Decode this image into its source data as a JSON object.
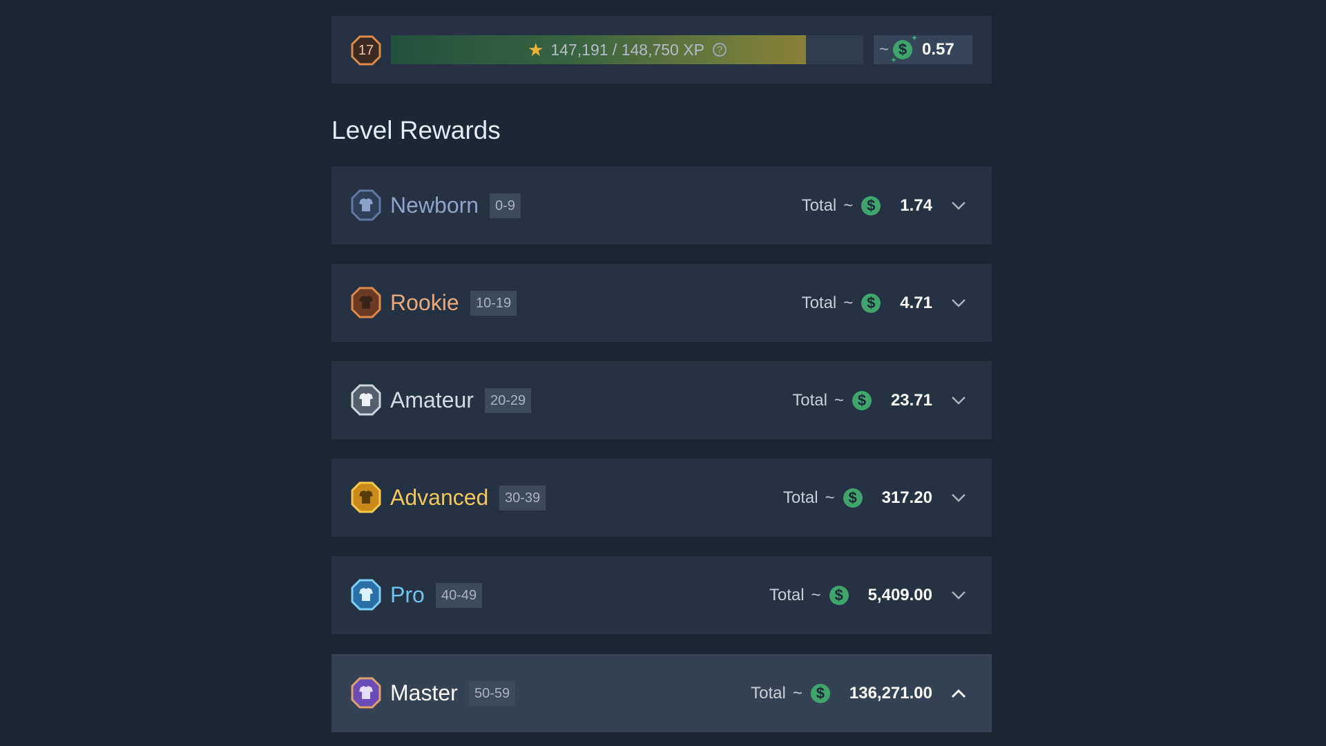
{
  "header": {
    "level": "17",
    "xp_text": "147,191 / 148,750 XP",
    "xp_progress": 0.9431,
    "balance_prefix": "~",
    "balance": "0.57"
  },
  "section_title": "Level Rewards",
  "tiers": [
    {
      "name": "Newborn",
      "range": "0-9",
      "total_label": "Total",
      "tilde": "~",
      "amount": "1.74",
      "color": "#8ea4c8",
      "expanded": false
    },
    {
      "name": "Rookie",
      "range": "10-19",
      "total_label": "Total",
      "tilde": "~",
      "amount": "4.71",
      "color": "#e9a97c",
      "expanded": false
    },
    {
      "name": "Amateur",
      "range": "20-29",
      "total_label": "Total",
      "tilde": "~",
      "amount": "23.71",
      "color": "#d4dbe3",
      "expanded": false
    },
    {
      "name": "Advanced",
      "range": "30-39",
      "total_label": "Total",
      "tilde": "~",
      "amount": "317.20",
      "color": "#f3c85a",
      "expanded": false
    },
    {
      "name": "Pro",
      "range": "40-49",
      "total_label": "Total",
      "tilde": "~",
      "amount": "5,409.00",
      "color": "#6ec6ee",
      "expanded": false
    },
    {
      "name": "Master",
      "range": "50-59",
      "total_label": "Total",
      "tilde": "~",
      "amount": "136,271.00",
      "color": "#ffffff",
      "expanded": true
    }
  ],
  "colors": {
    "background": "#1c2736",
    "card": "#253244",
    "card_expanded": "#334254",
    "coin": "#3fa56c",
    "xp_star": "#f0b434"
  },
  "icons": {
    "level_badge": "octagon-badge-icon",
    "xp_star": "star-icon",
    "help": "question-circle-icon",
    "currency": "dollar-coin-icon",
    "tier_badge": "shirt-octagon-icon",
    "expand": "chevron-down-icon",
    "collapse": "chevron-up-icon"
  }
}
